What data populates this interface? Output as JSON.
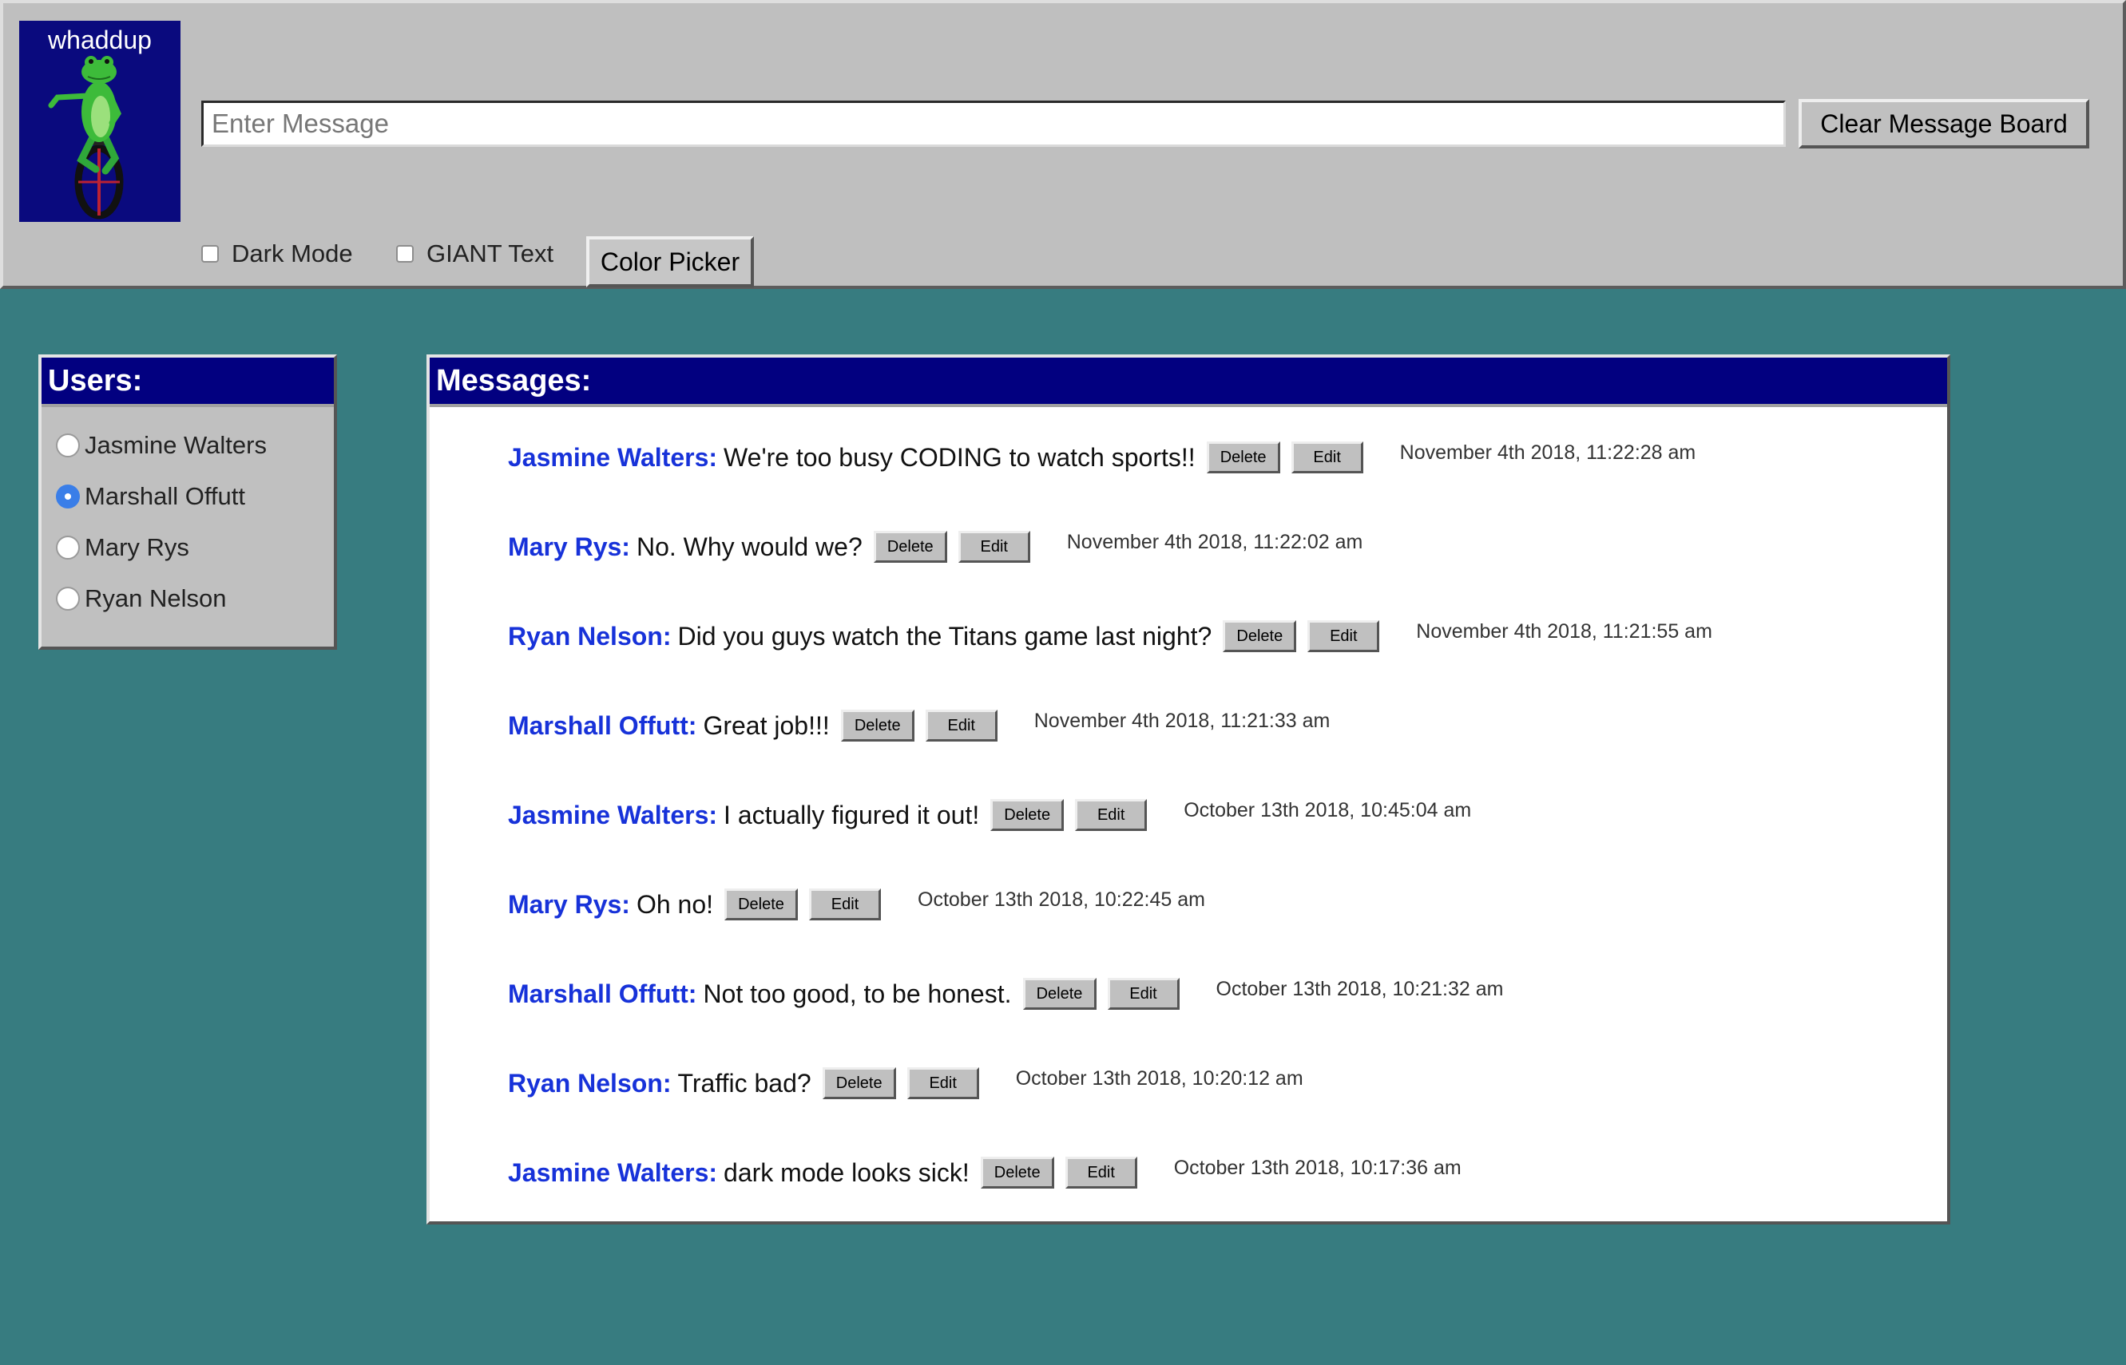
{
  "logo": {
    "text": "whaddup"
  },
  "composer": {
    "placeholder": "Enter Message",
    "value": "",
    "clear_label": "Clear Message Board"
  },
  "options": {
    "dark_mode_label": "Dark Mode",
    "dark_mode_checked": false,
    "giant_text_label": "GIANT Text",
    "giant_text_checked": false,
    "color_picker_label": "Color Picker"
  },
  "users_panel": {
    "title": "Users:",
    "selected": "Marshall Offutt",
    "users": [
      {
        "name": "Jasmine Walters",
        "selected": false
      },
      {
        "name": "Marshall Offutt",
        "selected": true
      },
      {
        "name": "Mary Rys",
        "selected": false
      },
      {
        "name": "Ryan Nelson",
        "selected": false
      }
    ]
  },
  "messages_panel": {
    "title": "Messages:",
    "delete_label": "Delete",
    "edit_label": "Edit",
    "messages": [
      {
        "author": "Jasmine Walters:",
        "text": "We're too busy CODING to watch sports!!",
        "time": "November 4th 2018, 11:22:28 am"
      },
      {
        "author": "Mary Rys:",
        "text": "No. Why would we?",
        "time": "November 4th 2018, 11:22:02 am"
      },
      {
        "author": "Ryan Nelson:",
        "text": "Did you guys watch the Titans game last night?",
        "time": "November 4th 2018, 11:21:55 am"
      },
      {
        "author": "Marshall Offutt:",
        "text": "Great job!!!",
        "time": "November 4th 2018, 11:21:33 am"
      },
      {
        "author": "Jasmine Walters:",
        "text": "I actually figured it out!",
        "time": "October 13th 2018, 10:45:04 am"
      },
      {
        "author": "Mary Rys:",
        "text": "Oh no!",
        "time": "October 13th 2018, 10:22:45 am"
      },
      {
        "author": "Marshall Offutt:",
        "text": "Not too good, to be honest.",
        "time": "October 13th 2018, 10:21:32 am"
      },
      {
        "author": "Ryan Nelson:",
        "text": "Traffic bad?",
        "time": "October 13th 2018, 10:20:12 am"
      },
      {
        "author": "Jasmine Walters:",
        "text": "dark mode looks sick!",
        "time": "October 13th 2018, 10:17:36 am"
      }
    ]
  },
  "colors": {
    "background": "#377c80",
    "header": "#bfbfbf",
    "title_bar": "#020080",
    "author": "#1732d9",
    "radio_selected": "#3a7ee8"
  }
}
